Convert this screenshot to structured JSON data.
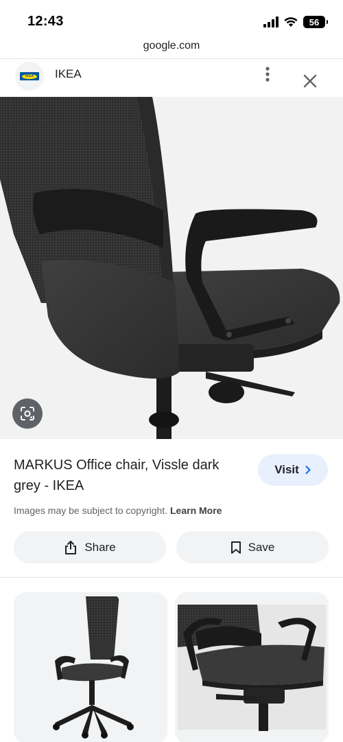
{
  "status_bar": {
    "time": "12:43",
    "battery": "56",
    "icons": [
      "signal-icon",
      "wifi-icon",
      "battery-icon"
    ]
  },
  "browser": {
    "url": "google.com"
  },
  "header": {
    "site_name": "IKEA",
    "logo_text": "IKEA",
    "icons": [
      "more-vert-icon",
      "close-icon"
    ]
  },
  "result": {
    "title": "MARKUS Office chair, Vissle dark grey - IKEA",
    "visit_label": "Visit",
    "copyright_text": "Images may be subject to copyright.",
    "learn_more_label": "Learn More",
    "share_label": "Share",
    "save_label": "Save"
  },
  "colors": {
    "visit_bg": "#e8f0fe",
    "button_bg": "#f1f3f4",
    "hero_bg": "#f2f2f2",
    "chair_dark": "#3a3a3a"
  }
}
